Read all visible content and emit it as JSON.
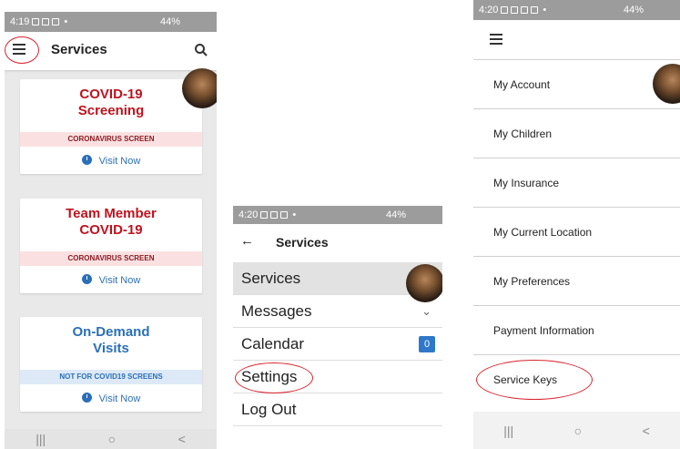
{
  "panel_a": {
    "status": {
      "time": "4:19",
      "battery": "44%"
    },
    "title": "Services",
    "icons": {
      "menu": "hamburger-icon",
      "search": "search-icon"
    },
    "cards": [
      {
        "title_line1": "COVID-19",
        "title_line2": "Screening",
        "banner": "CORONAVIRUS SCREEN",
        "action": "Visit Now",
        "title_color": "#c0121e",
        "banner_bg": "#fbe0e2"
      },
      {
        "title_line1": "Team Member",
        "title_line2": "COVID-19",
        "banner": "CORONAVIRUS SCREEN",
        "action": "Visit Now",
        "title_color": "#c0121e",
        "banner_bg": "#fbe0e2"
      },
      {
        "title_line1": "On-Demand",
        "title_line2": "Visits",
        "banner": "NOT FOR COVID19 SCREENS",
        "action": "Visit Now",
        "title_color": "#2a6fb7",
        "banner_bg": "#dde9f7"
      }
    ]
  },
  "panel_b": {
    "status": {
      "time": "4:20",
      "battery": "44%"
    },
    "title": "Services",
    "menu": [
      "Services",
      "Messages",
      "Calendar",
      "Settings",
      "Log Out"
    ],
    "calendar_badge": "0"
  },
  "panel_c": {
    "status": {
      "time": "4:20",
      "battery": "44%"
    },
    "menu": [
      "My Account",
      "My Children",
      "My Insurance",
      "My Current Location",
      "My Preferences",
      "Payment Information",
      "Service Keys"
    ]
  },
  "nav": {
    "recents": "|||",
    "home": "○",
    "back": "<"
  },
  "colors": {
    "highlight": "#d9232e",
    "accent_blue": "#2a6fb7",
    "status_bar": "#9c9c9c"
  }
}
